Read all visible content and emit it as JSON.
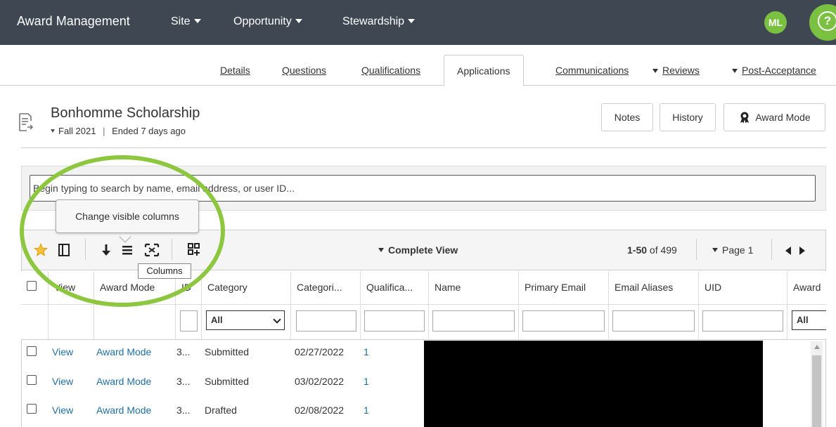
{
  "topbar": {
    "title": "Award Management",
    "nav": [
      {
        "label": "Site"
      },
      {
        "label": "Opportunity"
      },
      {
        "label": "Stewardship"
      }
    ],
    "avatar_initials": "ML",
    "help_glyph": "?",
    "accent": "#7ac142",
    "bg": "#3f4752"
  },
  "tabs": [
    {
      "label": "Details"
    },
    {
      "label": "Questions"
    },
    {
      "label": "Qualifications"
    },
    {
      "label": "Applications",
      "active": true
    },
    {
      "label": "Communications"
    },
    {
      "label": "Reviews",
      "dropdown": true
    },
    {
      "label": "Post-Acceptance",
      "dropdown": true
    }
  ],
  "opportunity": {
    "title": "Bonhomme Scholarship",
    "term": "Fall 2021",
    "separator": "|",
    "status": "Ended 7 days ago",
    "icon": "document-list-icon"
  },
  "header_buttons": {
    "notes": "Notes",
    "history": "History",
    "award_mode": "Award Mode"
  },
  "search": {
    "placeholder": "Begin typing to search by name, email address, or user ID..."
  },
  "toolbar": {
    "tooltip": "Change visible columns",
    "mini_tooltip": "Columns",
    "view": "Complete View",
    "range": "1-50",
    "of_total": " of 499",
    "page": "Page 1",
    "icons": [
      "star-icon",
      "panel-toggle-icon",
      "download-icon",
      "columns-icon",
      "fit-columns-icon",
      "add-widget-icon"
    ]
  },
  "table": {
    "columns": [
      "View",
      "Award Mode",
      "ID",
      "Category",
      "Categori...",
      "Qualifica...",
      "Name",
      "Primary Email",
      "Email Aliases",
      "UID",
      "Award"
    ],
    "category_filter": "All",
    "award_filter": "All",
    "rows": [
      {
        "view": "View",
        "award_mode": "Award Mode",
        "id": "3...",
        "category": "Submitted",
        "date": "02/27/2022",
        "qual": "1"
      },
      {
        "view": "View",
        "award_mode": "Award Mode",
        "id": "3...",
        "category": "Submitted",
        "date": "03/02/2022",
        "qual": "1"
      },
      {
        "view": "View",
        "award_mode": "Award Mode",
        "id": "3...",
        "category": "Drafted",
        "date": "02/08/2022",
        "qual": "1"
      }
    ]
  },
  "annotation_color": "#8dc63f"
}
